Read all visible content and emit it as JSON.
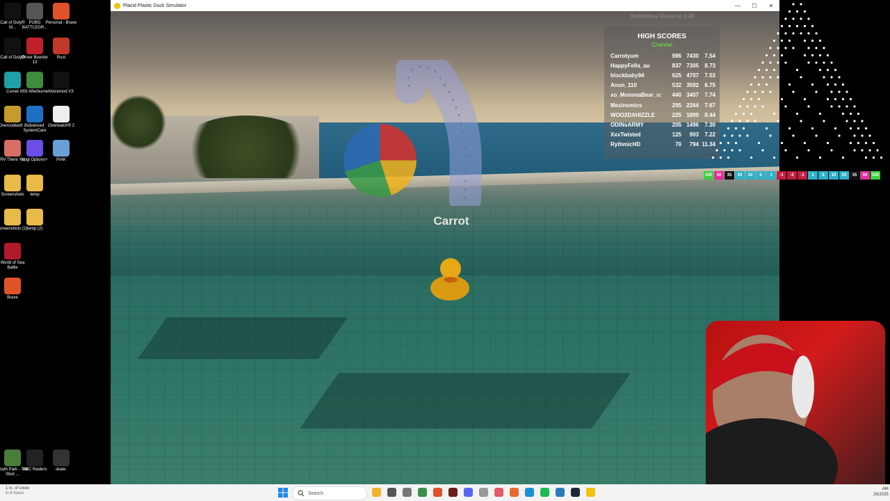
{
  "desktop": {
    "icons": [
      {
        "label": "Call of Duty® M...",
        "color": "#111"
      },
      {
        "label": "PUBG BATTLEGR...",
        "color": "#555"
      },
      {
        "label": "Personal - Brave",
        "color": "#e0522a"
      },
      {
        "label": "Call of Duty®",
        "color": "#111"
      },
      {
        "label": "Driver Booster 13",
        "color": "#c0202a"
      },
      {
        "label": "Rust",
        "color": "#c1392b"
      },
      {
        "label": "Comet",
        "color": "#1fa0a6"
      },
      {
        "label": "MSI Afterburner",
        "color": "#3d8b3d"
      },
      {
        "label": "Voicemod V3",
        "color": "#111"
      },
      {
        "label": "Overcooked! 2",
        "color": "#c79a2e"
      },
      {
        "label": "Advanced SystemCare",
        "color": "#1d6fc4"
      },
      {
        "label": "Overwatch® 2",
        "color": "#eee"
      },
      {
        "label": "RV There Yet",
        "color": "#d86e66"
      },
      {
        "label": "Logi Options+",
        "color": "#6b4ee6"
      },
      {
        "label": "PIAK",
        "color": "#6aa0d8"
      },
      {
        "label": "Screenshots",
        "color": "#e9b949"
      },
      {
        "label": "temp",
        "color": "#e9b949"
      },
      {
        "label": "Screenshots (2)",
        "color": "#e9b949"
      },
      {
        "label": "temp (2)",
        "color": "#e9b949"
      },
      {
        "label": "World of Sea Battle",
        "color": "#b01a2a"
      },
      {
        "label": "Brave",
        "color": "#e0522a"
      },
      {
        "label": "South Park - The Stick ...",
        "color": "#4a7c3a"
      },
      {
        "label": "ARC Raiders",
        "color": "#222"
      },
      {
        "label": "skate.",
        "color": "#333"
      }
    ]
  },
  "window": {
    "title": "Placid Plastic Duck Simulator",
    "minimize": "—",
    "maximize": "☐",
    "close": "✕"
  },
  "game": {
    "duck_name": "Carrot",
    "timer_text": "Watchtime Reset in 0:45"
  },
  "high_scores": {
    "title": "HIGH SCORES",
    "subtitle": "Channel",
    "rows": [
      {
        "name": "Carrotyum",
        "a": "986",
        "b": "7430",
        "c": "7.54"
      },
      {
        "name": "HappyFella_au",
        "a": "837",
        "b": "7305",
        "c": "8.73"
      },
      {
        "name": "blockbaby94",
        "a": "625",
        "b": "4707",
        "c": "7.53"
      },
      {
        "name": "Anon_110",
        "a": "532",
        "b": "3592",
        "c": "6.75"
      },
      {
        "name": "xo_MommaBear_o:",
        "a": "440",
        "b": "3407",
        "c": "7.74"
      },
      {
        "name": "Mezinomics",
        "a": "295",
        "b": "2264",
        "c": "7.67"
      },
      {
        "name": "WOO2DAHIZZLE",
        "a": "225",
        "b": "1899",
        "c": "8.44"
      },
      {
        "name": "ODINsARMY",
        "a": "205",
        "b": "1496",
        "c": "7.30"
      },
      {
        "name": "XxxTwisted",
        "a": "125",
        "b": "903",
        "c": "7.22"
      },
      {
        "name": "RythmicHD",
        "a": "70",
        "b": "794",
        "c": "11.34"
      }
    ]
  },
  "multipliers": [
    {
      "v": "100",
      "color": "#3ecf3e"
    },
    {
      "v": "50",
      "color": "#e0309a"
    },
    {
      "v": "35",
      "color": "#111"
    },
    {
      "v": "20",
      "color": "#2fb0c8"
    },
    {
      "v": "10",
      "color": "#2fb0c8"
    },
    {
      "v": "5",
      "color": "#2fb0c8"
    },
    {
      "v": "1",
      "color": "#2fb0c8"
    },
    {
      "v": "-1",
      "color": "#c02040"
    },
    {
      "v": "-2",
      "color": "#c02040"
    },
    {
      "v": "-1",
      "color": "#c02040"
    },
    {
      "v": "1",
      "color": "#2fb0c8"
    },
    {
      "v": "5",
      "color": "#2fb0c8"
    },
    {
      "v": "10",
      "color": "#2fb0c8"
    },
    {
      "v": "20",
      "color": "#2fb0c8"
    },
    {
      "v": "35",
      "color": "#111"
    },
    {
      "v": "50",
      "color": "#e0309a"
    },
    {
      "v": "100",
      "color": "#3ecf3e"
    }
  ],
  "taskbar": {
    "weather_line1": "1 in. of snow",
    "weather_line2": "in 8 hours",
    "search_placeholder": "Search",
    "clock_line1": "AM",
    "clock_line2": "26/2025",
    "apps": [
      {
        "name": "file-explorer-icon",
        "color": "#f0b429"
      },
      {
        "name": "calculator-icon",
        "color": "#555"
      },
      {
        "name": "settings-icon",
        "color": "#777"
      },
      {
        "name": "chrome-icon",
        "color": "#3c8f4c"
      },
      {
        "name": "brave-icon",
        "color": "#e0522a"
      },
      {
        "name": "app-icon",
        "color": "#6b1d1d"
      },
      {
        "name": "discord-icon",
        "color": "#5865f2"
      },
      {
        "name": "app-icon-2",
        "color": "#999"
      },
      {
        "name": "maps-icon",
        "color": "#e25b6a"
      },
      {
        "name": "app-icon-3",
        "color": "#e56a2e"
      },
      {
        "name": "edge-icon",
        "color": "#1f8fd6"
      },
      {
        "name": "spotify-icon",
        "color": "#1db954"
      },
      {
        "name": "app-icon-4",
        "color": "#2a7bbd"
      },
      {
        "name": "steam-icon",
        "color": "#1b2838"
      },
      {
        "name": "duck-game-icon",
        "color": "#f4c20d"
      }
    ]
  }
}
